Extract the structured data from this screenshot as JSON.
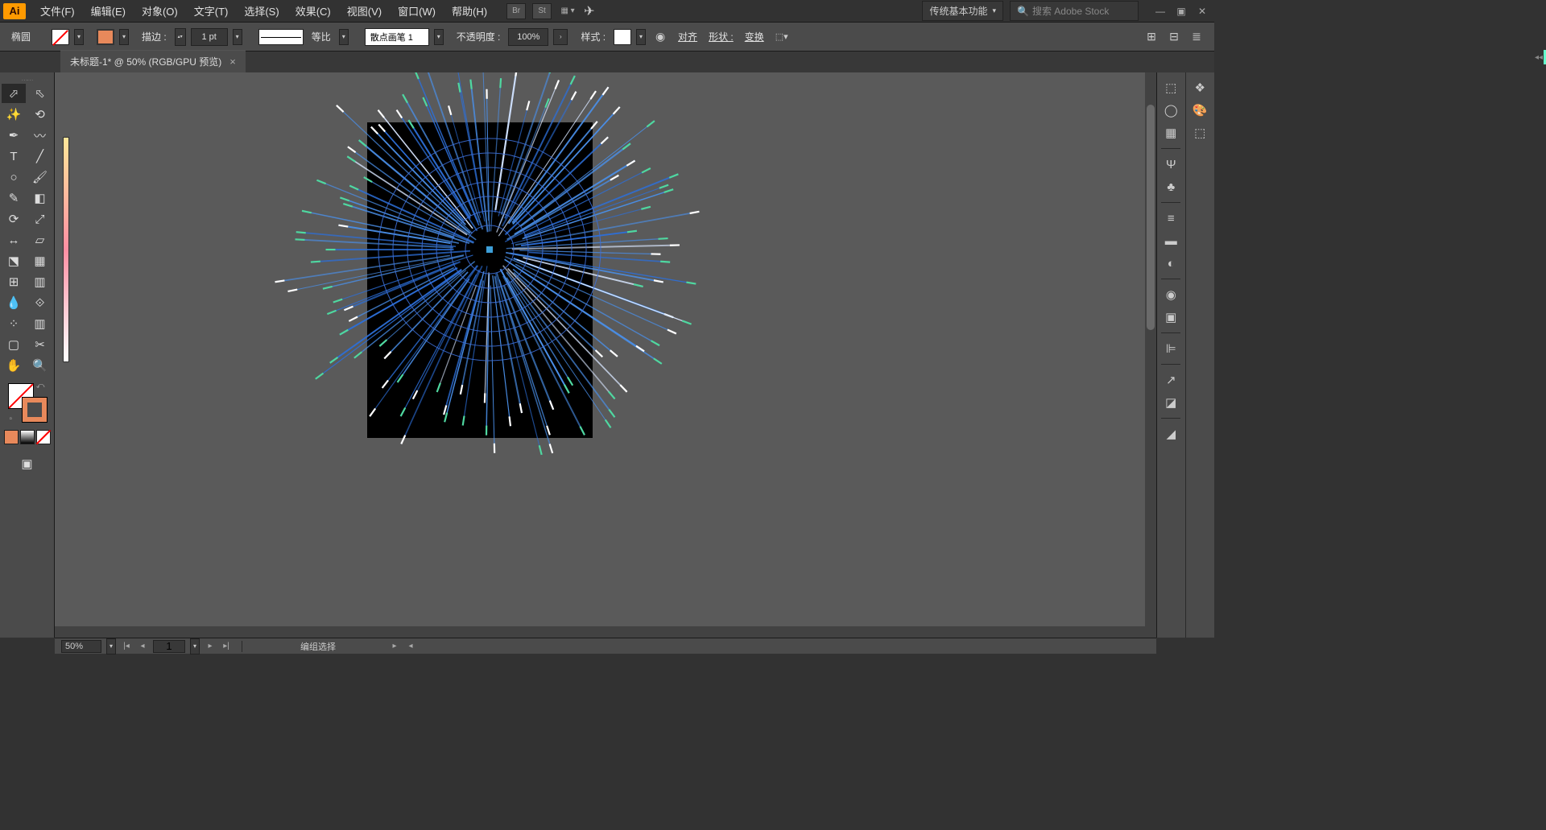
{
  "app": {
    "logo": "Ai"
  },
  "menu": {
    "items": [
      "文件(F)",
      "编辑(E)",
      "对象(O)",
      "文字(T)",
      "选择(S)",
      "效果(C)",
      "视图(V)",
      "窗口(W)",
      "帮助(H)"
    ],
    "bridge": "Br",
    "stock": "St"
  },
  "workspace": {
    "label": "传统基本功能"
  },
  "search": {
    "placeholder": "搜索 Adobe Stock"
  },
  "control": {
    "toolName": "椭圆",
    "strokeLabel": "描边 :",
    "strokeWeight": "1 pt",
    "uniform": "等比",
    "brushName": "散点画笔 1",
    "opacityLabel": "不透明度 :",
    "opacity": "100%",
    "styleLabel": "样式 :",
    "alignLabel": "对齐",
    "shapeLabel": "形状 :",
    "transformLabel": "变换"
  },
  "tab": {
    "title": "未标题-1* @ 50% (RGB/GPU 预览)"
  },
  "status": {
    "zoom": "50%",
    "artboard": "1",
    "selection": "编组选择"
  },
  "colors": {
    "stroke": "#e8895b",
    "accent": "#ff9a00"
  }
}
